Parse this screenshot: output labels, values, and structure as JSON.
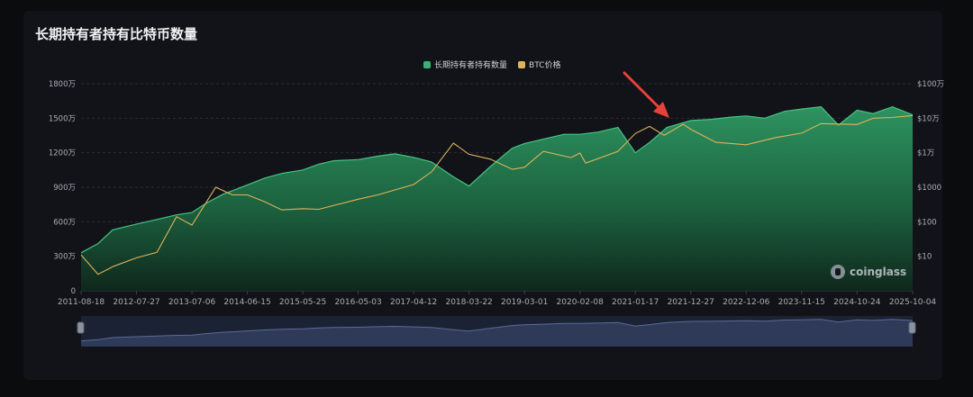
{
  "page": {
    "title": "长期持有者持有比特币数量"
  },
  "legend": {
    "items": [
      {
        "label": "长期持有者持有数量",
        "color": "#3bb273"
      },
      {
        "label": "BTC价格",
        "color": "#e0b35a"
      }
    ]
  },
  "watermark": {
    "text": "coinglass"
  },
  "chart_data": {
    "type": "area",
    "title": "长期持有者持有比特币数量",
    "x_ticks": [
      "2011-08-18",
      "2012-07-27",
      "2013-07-06",
      "2014-06-15",
      "2015-05-25",
      "2016-05-03",
      "2017-04-12",
      "2018-03-22",
      "2019-03-01",
      "2020-02-08",
      "2021-01-17",
      "2021-12-27",
      "2022-12-06",
      "2023-11-15",
      "2024-10-24",
      "2025-10-04"
    ],
    "y_left_ticks": [
      "0",
      "300万",
      "600万",
      "900万",
      "1200万",
      "1500万",
      "1800万"
    ],
    "y_left_range": [
      0,
      18000000
    ],
    "y_right_ticks": [
      "$10",
      "$100",
      "$1000",
      "$1万",
      "$10万",
      "$100万"
    ],
    "y_right_scale": "log",
    "y_right_range": [
      1,
      1000000
    ],
    "legend_position": "top-center",
    "grid": "horizontal dashed",
    "series": [
      {
        "name": "长期持有者持有数量",
        "axis": "left",
        "x": [
          "2011-08-18",
          "2011-12-01",
          "2012-03-01",
          "2012-07-27",
          "2012-12-01",
          "2013-04-01",
          "2013-07-06",
          "2013-10-01",
          "2014-01-15",
          "2014-03-15",
          "2014-06-15",
          "2014-10-01",
          "2015-01-15",
          "2015-05-25",
          "2015-09-01",
          "2015-12-01",
          "2016-05-03",
          "2016-09-01",
          "2016-12-15",
          "2017-04-12",
          "2017-08-01",
          "2017-12-15",
          "2018-03-22",
          "2018-08-01",
          "2018-12-15",
          "2019-03-01",
          "2019-07-01",
          "2019-11-01",
          "2020-02-08",
          "2020-06-01",
          "2020-10-01",
          "2021-01-17",
          "2021-04-15",
          "2021-08-01",
          "2021-12-27",
          "2022-05-01",
          "2022-09-01",
          "2022-12-06",
          "2023-04-01",
          "2023-08-01",
          "2023-11-15",
          "2024-03-15",
          "2024-07-01",
          "2024-10-24",
          "2025-02-01",
          "2025-06-01",
          "2025-10-04"
        ],
        "values": [
          3300000,
          4100000,
          5300000,
          5800000,
          6200000,
          6600000,
          6800000,
          7600000,
          8400000,
          8700000,
          9200000,
          9800000,
          10200000,
          10500000,
          11000000,
          11300000,
          11400000,
          11700000,
          11900000,
          11600000,
          11200000,
          9900000,
          9100000,
          10800000,
          12400000,
          12800000,
          13200000,
          13600000,
          13600000,
          13800000,
          14200000,
          12000000,
          12900000,
          14200000,
          14800000,
          14900000,
          15100000,
          15200000,
          15000000,
          15600000,
          15800000,
          16000000,
          14400000,
          15700000,
          15400000,
          16000000,
          15300000
        ]
      },
      {
        "name": "BTC价格",
        "axis": "right",
        "x": [
          "2011-08-18",
          "2011-12-01",
          "2012-03-01",
          "2012-07-27",
          "2012-12-01",
          "2013-04-01",
          "2013-07-06",
          "2013-12-01",
          "2014-03-15",
          "2014-06-15",
          "2014-10-01",
          "2015-01-15",
          "2015-05-25",
          "2015-09-01",
          "2016-05-03",
          "2016-09-01",
          "2017-04-12",
          "2017-08-01",
          "2017-12-15",
          "2018-03-22",
          "2018-08-01",
          "2018-12-15",
          "2019-03-01",
          "2019-06-26",
          "2019-12-15",
          "2020-02-08",
          "2020-03-15",
          "2020-10-01",
          "2021-01-17",
          "2021-04-15",
          "2021-07-15",
          "2021-11-10",
          "2021-12-27",
          "2022-06-01",
          "2022-12-06",
          "2023-06-01",
          "2023-11-15",
          "2024-03-15",
          "2024-10-24",
          "2025-02-01",
          "2025-06-01",
          "2025-10-04"
        ],
        "values": [
          11,
          3,
          5,
          9,
          13,
          140,
          80,
          1000,
          600,
          600,
          380,
          220,
          240,
          230,
          450,
          600,
          1200,
          2800,
          19000,
          9000,
          6500,
          3300,
          3800,
          11000,
          7200,
          9800,
          5000,
          11000,
          36000,
          58000,
          32000,
          67000,
          48000,
          20000,
          17000,
          27000,
          37000,
          70000,
          66000,
          100000,
          105000,
          120000
        ]
      }
    ]
  }
}
